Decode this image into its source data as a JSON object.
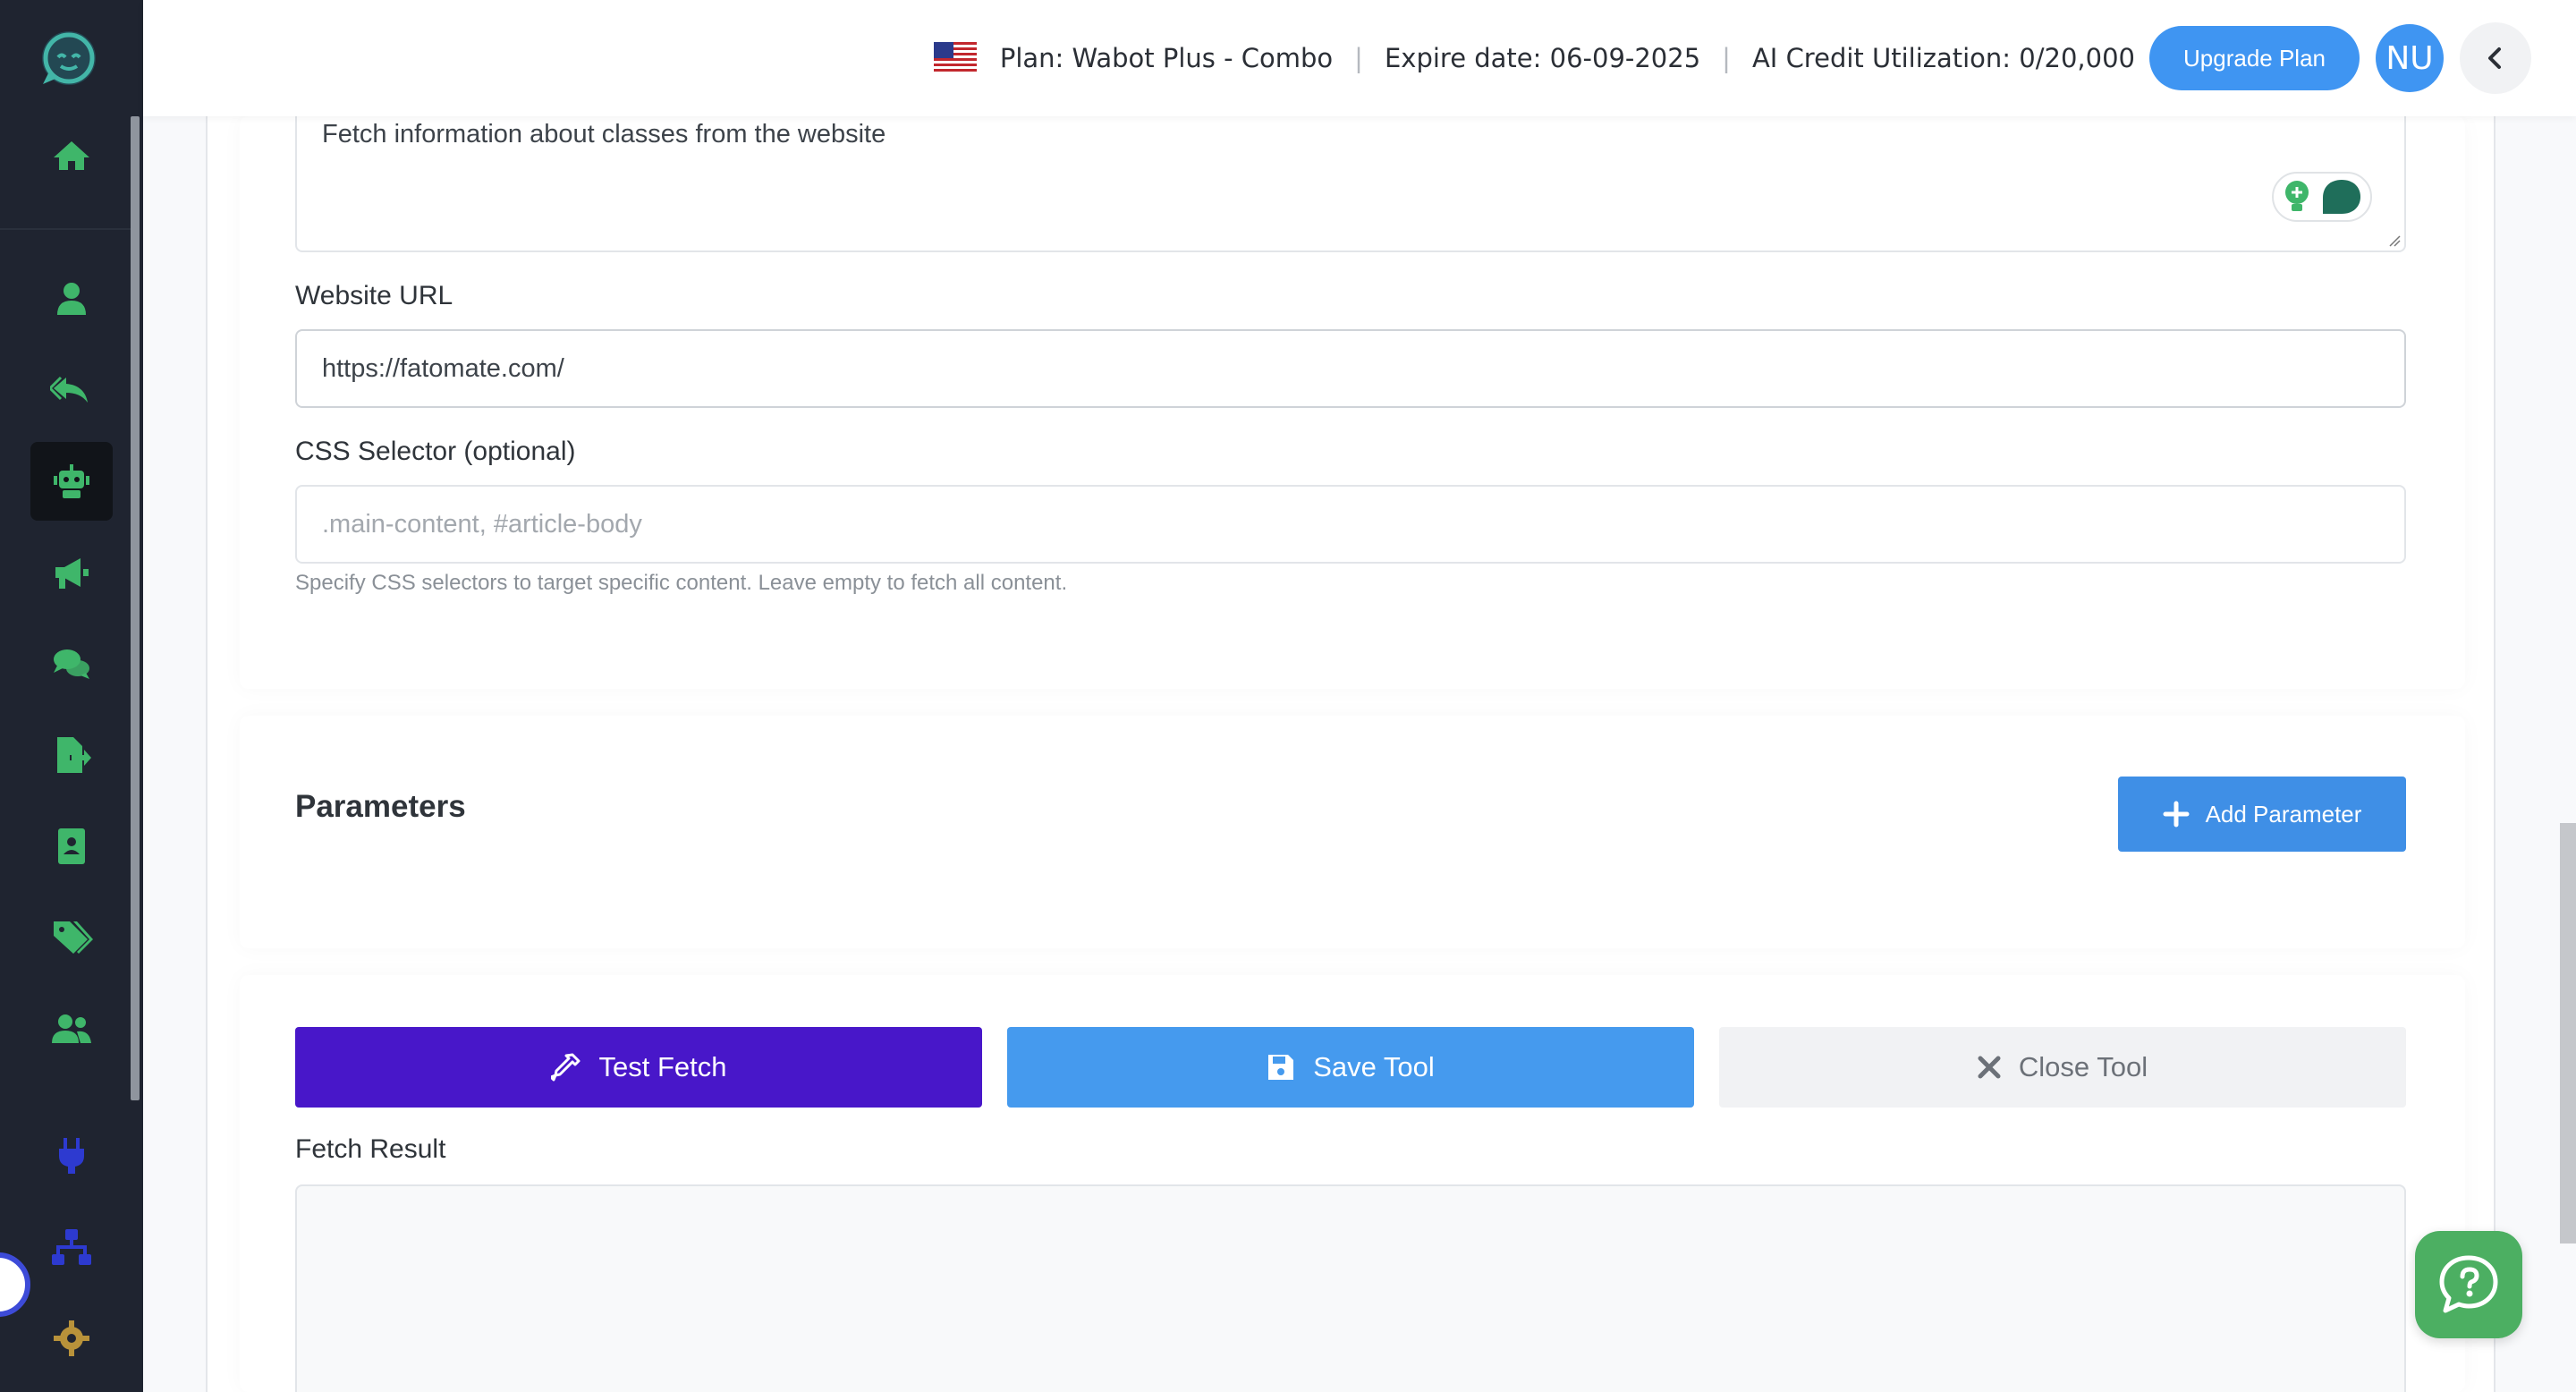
{
  "header": {
    "plan_text": "Plan: Wabot Plus - Combo",
    "separator": "|",
    "expire_text": "Expire date: 06-09-2025",
    "credit_text": "AI Credit Utilization: 0/20,000",
    "upgrade_label": "Upgrade Plan",
    "avatar_initials": "NU"
  },
  "sidebar": {
    "items": [
      {
        "icon": "home-icon"
      },
      {
        "icon": "user-icon"
      },
      {
        "icon": "reply-all-icon"
      },
      {
        "icon": "robot-icon",
        "active": true
      },
      {
        "icon": "megaphone-icon"
      },
      {
        "icon": "chat-bubbles-icon"
      },
      {
        "icon": "file-export-icon"
      },
      {
        "icon": "contact-book-icon"
      },
      {
        "icon": "tags-icon"
      },
      {
        "icon": "users-group-icon"
      },
      {
        "icon": "plug-icon"
      },
      {
        "icon": "sitemap-icon"
      },
      {
        "icon": "gear-icon"
      }
    ]
  },
  "form": {
    "description_value": "Fetch information about classes from the website",
    "website_url_label": "Website URL",
    "website_url_value": "https://fatomate.com/",
    "css_selector_label": "CSS Selector (optional)",
    "css_selector_placeholder": ".main-content, #article-body",
    "css_selector_help": "Specify CSS selectors to target specific content. Leave empty to fetch all content."
  },
  "parameters": {
    "title": "Parameters",
    "add_label": "Add Parameter"
  },
  "actions": {
    "test_label": "Test Fetch",
    "save_label": "Save Tool",
    "close_label": "Close Tool"
  },
  "result": {
    "label": "Fetch Result",
    "value": ""
  },
  "colors": {
    "sidebar_bg": "#1f2430",
    "icon_green": "#3fb66a",
    "primary_blue": "#3f95f2",
    "test_purple": "#4817c9",
    "help_green": "#4caf62"
  }
}
